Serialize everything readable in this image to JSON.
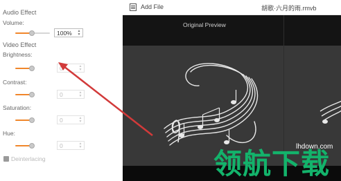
{
  "settings": {
    "audio_effect": "Audio Effect",
    "volume_label": "Volume:",
    "volume_value": "100%",
    "video_effect": "Video Effect",
    "brightness_label": "Brightness:",
    "brightness_value": "0",
    "contrast_label": "Contrast:",
    "contrast_value": "0",
    "saturation_label": "Saturation:",
    "saturation_value": "0",
    "hue_label": "Hue:",
    "hue_value": "0",
    "deinterlacing_label": "Deinterlacing"
  },
  "toolbar": {
    "add_file_label": "Add File",
    "file_name": "胡歌·六月的雨.rmvb"
  },
  "preview": {
    "original_label": "Original Preview"
  },
  "watermark": {
    "url": "lhdown.com",
    "chars": "领航下载"
  },
  "colors": {
    "accent": "#f0862a",
    "arrow": "#d23a3a",
    "watermark": "#13b36b"
  }
}
